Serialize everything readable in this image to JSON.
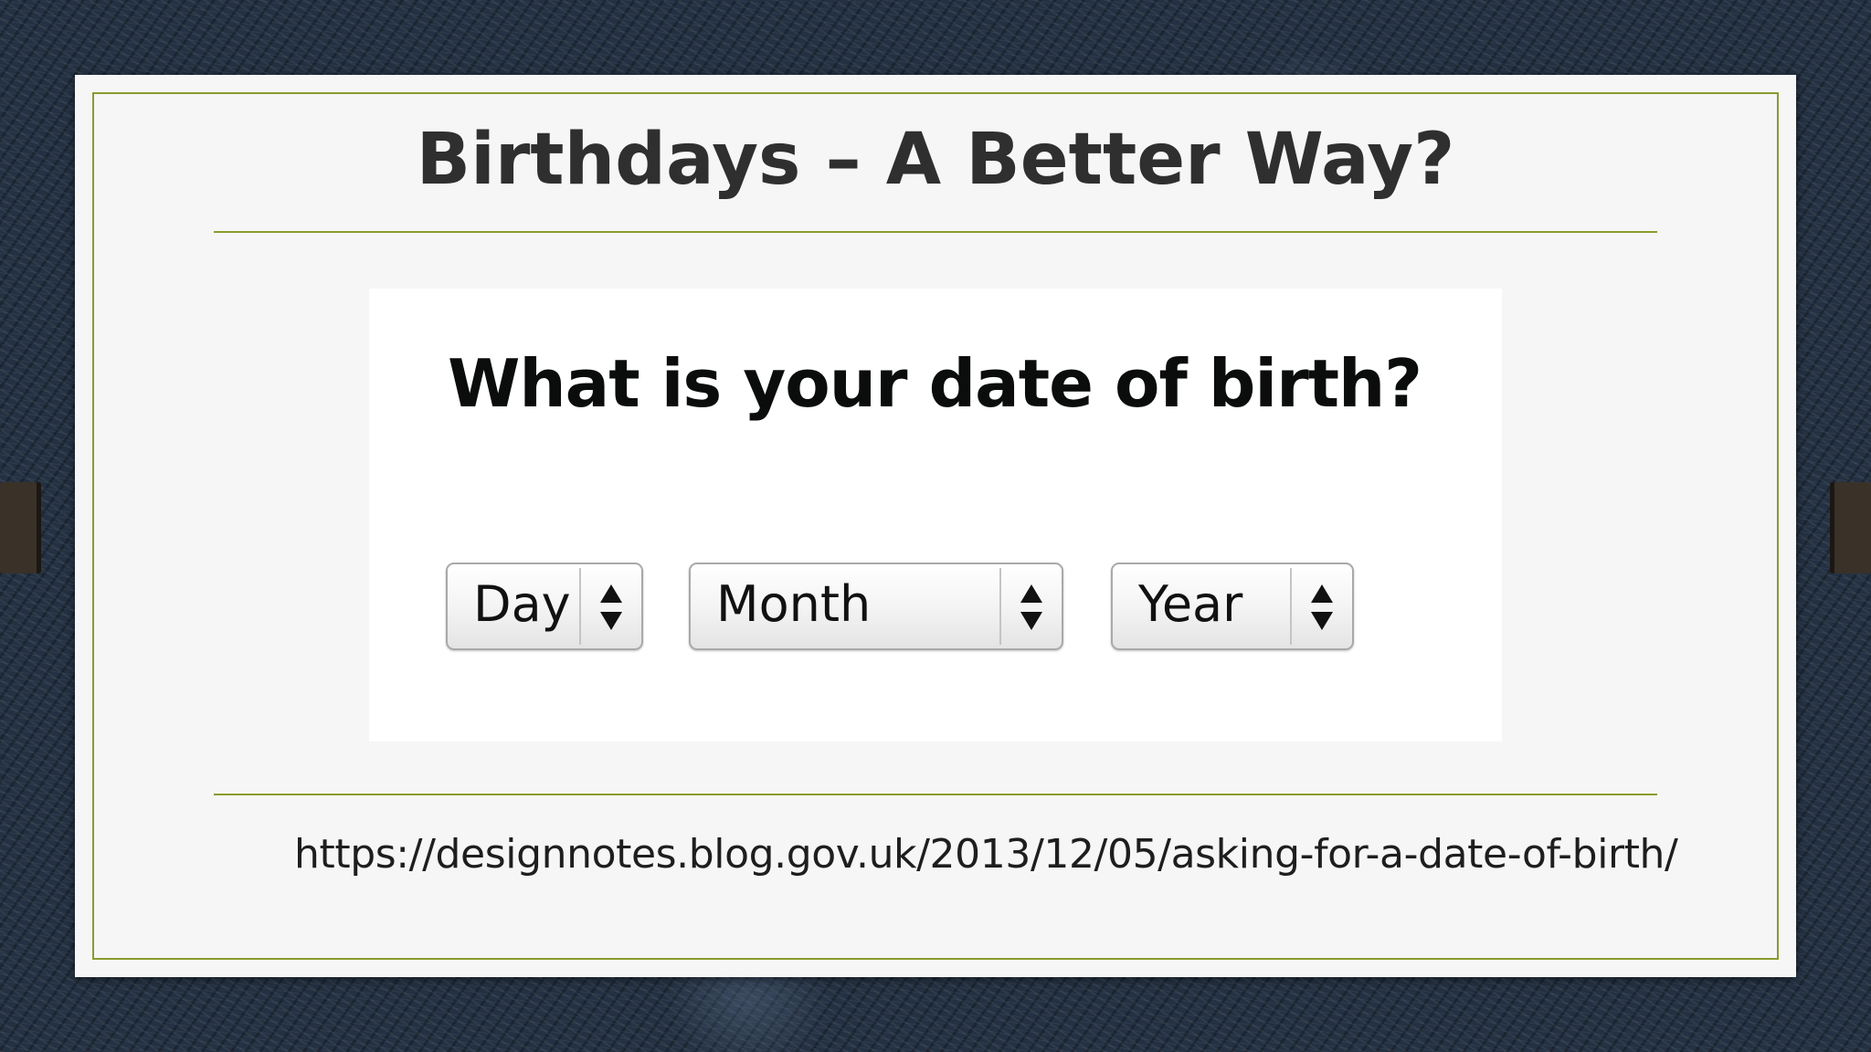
{
  "slide": {
    "title": "Birthdays – A Better Way?",
    "source_url": "https://designnotes.blog.gov.uk/2013/12/05/asking-for-a-date-of-birth/"
  },
  "form": {
    "question": "What is your date of birth?",
    "selects": [
      {
        "label": "Day",
        "icon": "up-down-arrows-icon"
      },
      {
        "label": "Month",
        "icon": "up-down-arrows-icon"
      },
      {
        "label": "Year",
        "icon": "up-down-arrows-icon"
      }
    ]
  },
  "colors": {
    "accent_line": "#8c9a2e",
    "background": "#243142",
    "card": "#f6f6f6",
    "clip": "#3a3128"
  }
}
